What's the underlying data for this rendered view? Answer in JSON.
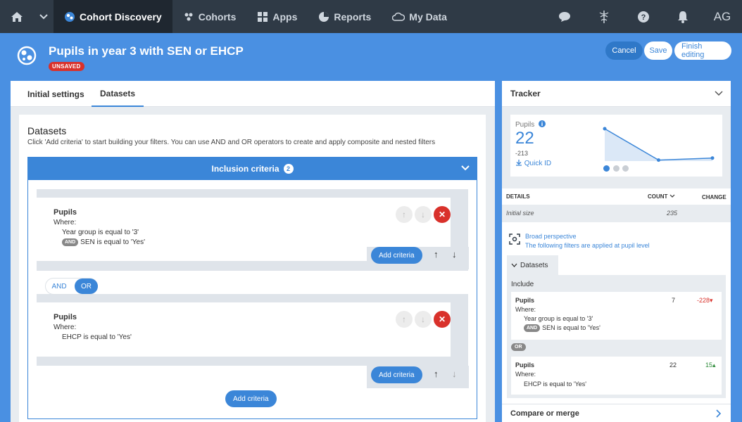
{
  "nav": {
    "items": [
      {
        "label": "Cohort Discovery",
        "icon": "cohort-discovery-icon"
      },
      {
        "label": "Cohorts",
        "icon": "cohorts-icon"
      },
      {
        "label": "Apps",
        "icon": "apps-grid-icon"
      },
      {
        "label": "Reports",
        "icon": "pie-chart-icon"
      },
      {
        "label": "My Data",
        "icon": "cloud-icon"
      }
    ],
    "user_initials": "AG"
  },
  "header": {
    "title": "Pupils in year 3 with SEN or EHCP",
    "status_badge": "UNSAVED",
    "cancel_label": "Cancel",
    "save_label": "Save",
    "finish_label": "Finish editing"
  },
  "tabs": [
    "Initial settings",
    "Datasets"
  ],
  "datasets": {
    "title": "Datasets",
    "help": "Click 'Add criteria' to start building your filters. You can use AND and OR operators to create and apply composite and nested filters",
    "inclusion_label": "Inclusion criteria",
    "inclusion_count": "2",
    "criteria": [
      {
        "title": "Pupils",
        "where": "Where:",
        "line1": "Year group is equal to '3'",
        "and_label": "AND",
        "line2": "SEN is equal to 'Yes'"
      },
      {
        "title": "Pupils",
        "where": "Where:",
        "line1": "EHCP is equal to 'Yes'"
      }
    ],
    "operator_and": "AND",
    "operator_or": "OR",
    "add_criteria": "Add criteria"
  },
  "tracker": {
    "title": "Tracker",
    "metric_label": "Pupils",
    "value": "22",
    "delta": "-213",
    "quick_id": "Quick ID",
    "details_label": "DETAILS",
    "count_label": "COUNT",
    "change_label": "CHANGE",
    "initial_label": "Initial size",
    "initial_count": "235",
    "broad_title": "Broad perspective",
    "broad_sub": "The following filters are applied at pupil level",
    "datasets_tab": "Datasets",
    "include_label": "Include",
    "mini1": {
      "title": "Pupils",
      "count": "7",
      "change": "-228",
      "where": "Where:",
      "line1": "Year group is equal to '3'",
      "and_label": "AND",
      "line2": "SEN is equal to 'Yes'"
    },
    "or_label": "OR",
    "mini2": {
      "title": "Pupils",
      "count": "22",
      "change": "15",
      "where": "Where:",
      "line1": "EHCP is equal to 'Yes'"
    },
    "compare_label": "Compare or merge",
    "sparkline_counts": [
      235,
      7,
      22
    ],
    "colors": {
      "accent": "#3b86d8",
      "negative": "#d9312b",
      "positive": "#2e8b3a"
    }
  }
}
